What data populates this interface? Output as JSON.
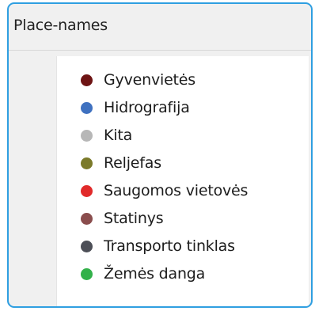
{
  "panel": {
    "title": "Place-names",
    "accent_color": "#2f9fe1"
  },
  "legend": {
    "items": [
      {
        "label": "Gyvenvietės",
        "color": "#6e1414",
        "icon": "filled-circle"
      },
      {
        "label": "Hidrografija",
        "color": "#3f71c0",
        "icon": "filled-circle"
      },
      {
        "label": "Kita",
        "color": "#b7b7b7",
        "icon": "filled-circle"
      },
      {
        "label": "Reljefas",
        "color": "#7b7a2a",
        "icon": "filled-circle"
      },
      {
        "label": "Saugomos vietovės",
        "color": "#e12a2a",
        "icon": "filled-circle"
      },
      {
        "label": "Statinys",
        "color": "#8a4d4d",
        "icon": "filled-circle"
      },
      {
        "label": "Transporto tinklas",
        "color": "#4d4f57",
        "icon": "filled-circle"
      },
      {
        "label": "Žemės danga",
        "color": "#33b14a",
        "icon": "filled-circle"
      }
    ]
  }
}
